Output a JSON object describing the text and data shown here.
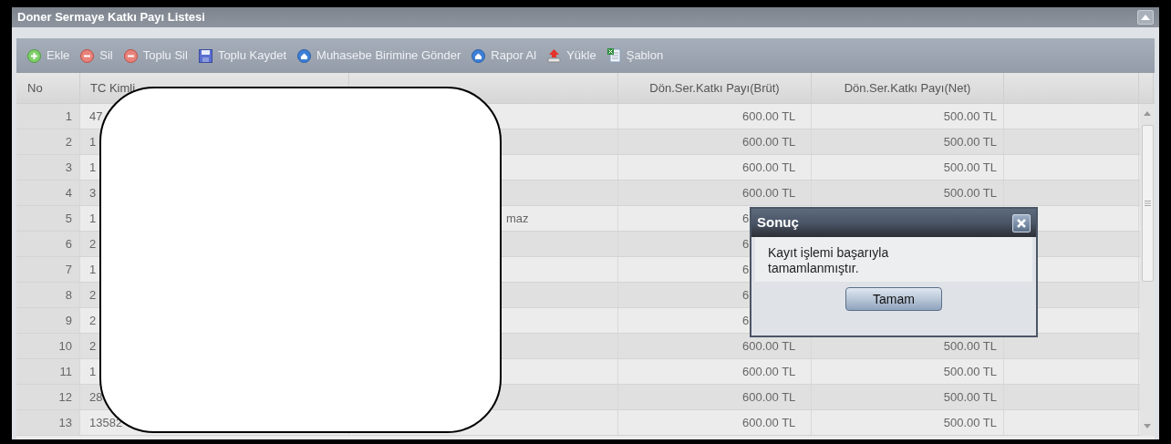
{
  "window": {
    "title": "Doner Sermaye Katkı Payı Listesi"
  },
  "toolbar": [
    {
      "label": "Ekle",
      "kind": "add"
    },
    {
      "label": "Sil",
      "kind": "remove"
    },
    {
      "label": "Toplu Sil",
      "kind": "remove"
    },
    {
      "label": "Toplu Kaydet",
      "kind": "save"
    },
    {
      "label": "Muhasebe Birimine Gönder",
      "kind": "send"
    },
    {
      "label": "Rapor Al",
      "kind": "send"
    },
    {
      "label": "Yükle",
      "kind": "upload"
    },
    {
      "label": "Şablon",
      "kind": "sheet"
    }
  ],
  "table": {
    "columns": [
      {
        "label": "No"
      },
      {
        "label": "TC Kimli"
      },
      {},
      {
        "label": "Dön.Ser.Katkı Payı(Brüt)"
      },
      {
        "label": "Dön.Ser.Katkı Payı(Net)"
      }
    ],
    "rows": [
      {
        "no": "1",
        "tc": "47",
        "brut": "600.00 TL",
        "net": "500.00 TL"
      },
      {
        "no": "2",
        "tc": "1",
        "brut": "600.00 TL",
        "net": "500.00 TL"
      },
      {
        "no": "3",
        "tc": "1",
        "brut": "600.00 TL",
        "net": "500.00 TL"
      },
      {
        "no": "4",
        "tc": "3",
        "brut": "600.00 TL",
        "net": "500.00 TL"
      },
      {
        "no": "5",
        "tc": "1",
        "name": "maz",
        "brut": "6"
      },
      {
        "no": "6",
        "tc": "2",
        "brut": "6"
      },
      {
        "no": "7",
        "tc": "1",
        "brut": "6"
      },
      {
        "no": "8",
        "tc": "2",
        "brut": "6"
      },
      {
        "no": "9",
        "tc": "2",
        "brut": "6"
      },
      {
        "no": "10",
        "tc": "2",
        "brut": "600.00 TL",
        "net": "500.00 TL"
      },
      {
        "no": "11",
        "tc": "1",
        "brut": "600.00 TL",
        "net": "500.00 TL"
      },
      {
        "no": "12",
        "tc": "28",
        "brut": "600.00 TL",
        "net": "500.00 TL"
      },
      {
        "no": "13",
        "tc": "13582",
        "brut": "600.00 TL",
        "net": "500.00 TL"
      }
    ]
  },
  "dialog": {
    "title": "Sonuç",
    "message": "Kayıt işlemi başarıyla tamamlanmıştır.",
    "button": "Tamam"
  }
}
